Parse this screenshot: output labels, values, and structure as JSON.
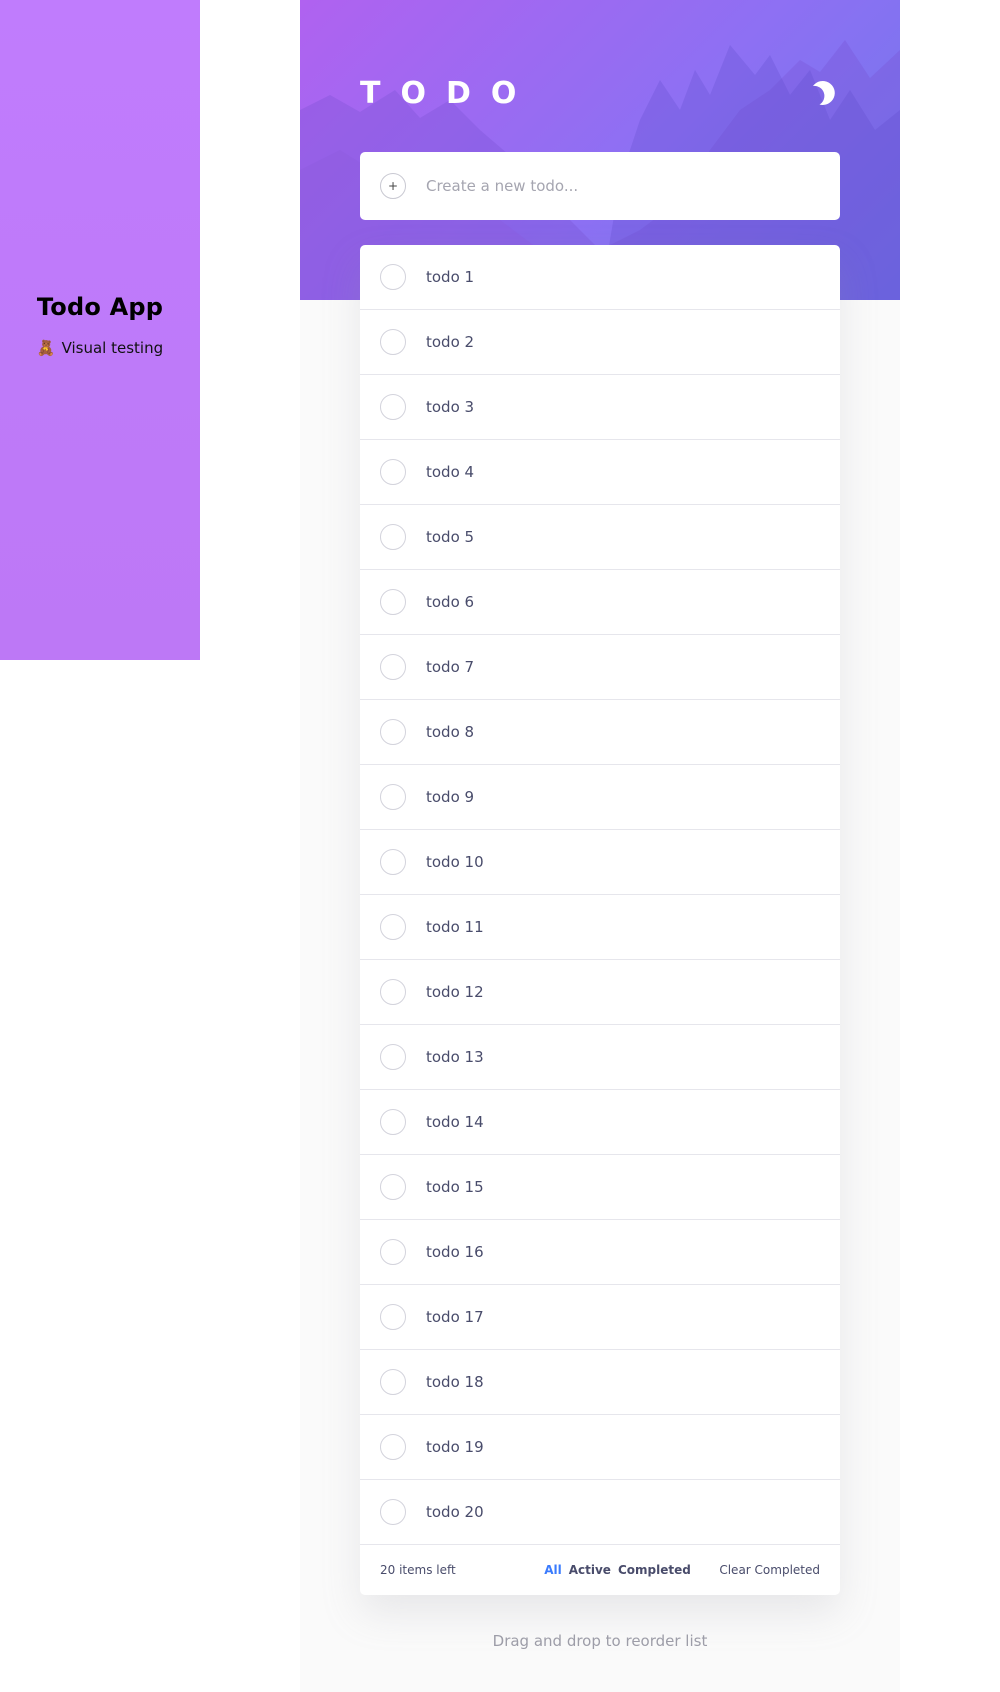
{
  "sidebar": {
    "title": "Todo App",
    "subtitle": "Visual testing",
    "subtitle_icon": "🧸"
  },
  "header": {
    "logo": "TODO",
    "theme_icon": "moon-icon"
  },
  "new_todo": {
    "placeholder": "Create a new todo...",
    "value": "",
    "add_icon": "+"
  },
  "todos": [
    {
      "text": "todo 1",
      "completed": false
    },
    {
      "text": "todo 2",
      "completed": false
    },
    {
      "text": "todo 3",
      "completed": false
    },
    {
      "text": "todo 4",
      "completed": false
    },
    {
      "text": "todo 5",
      "completed": false
    },
    {
      "text": "todo 6",
      "completed": false
    },
    {
      "text": "todo 7",
      "completed": false
    },
    {
      "text": "todo 8",
      "completed": false
    },
    {
      "text": "todo 9",
      "completed": false
    },
    {
      "text": "todo 10",
      "completed": false
    },
    {
      "text": "todo 11",
      "completed": false
    },
    {
      "text": "todo 12",
      "completed": false
    },
    {
      "text": "todo 13",
      "completed": false
    },
    {
      "text": "todo 14",
      "completed": false
    },
    {
      "text": "todo 15",
      "completed": false
    },
    {
      "text": "todo 16",
      "completed": false
    },
    {
      "text": "todo 17",
      "completed": false
    },
    {
      "text": "todo 18",
      "completed": false
    },
    {
      "text": "todo 19",
      "completed": false
    },
    {
      "text": "todo 20",
      "completed": false
    }
  ],
  "footer": {
    "items_left": "20 items left",
    "filters": [
      {
        "label": "All",
        "active": true
      },
      {
        "label": "Active",
        "active": false
      },
      {
        "label": "Completed",
        "active": false
      }
    ],
    "clear_label": "Clear Completed"
  },
  "hint": "Drag and drop to reorder list",
  "colors": {
    "accent": "#3a7bfd",
    "sidebar_bg": "#c07cfd",
    "hero_start": "#b062f0",
    "hero_end": "#6d78ec",
    "text": "#494c6b"
  }
}
